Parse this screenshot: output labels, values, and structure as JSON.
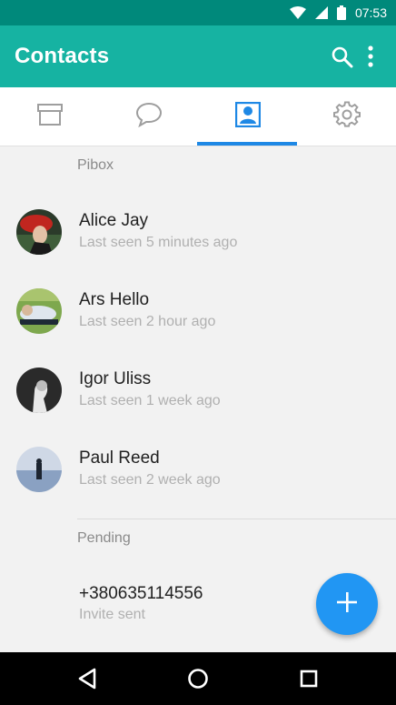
{
  "status_bar": {
    "time": "07:53"
  },
  "app_bar": {
    "title": "Contacts"
  },
  "tabs": [
    {
      "name": "archive",
      "icon": "archive-icon"
    },
    {
      "name": "chats",
      "icon": "chat-bubble-icon"
    },
    {
      "name": "contacts",
      "icon": "contact-card-icon",
      "selected": true
    },
    {
      "name": "settings",
      "icon": "gear-icon"
    }
  ],
  "sections": {
    "pibox": "Pibox",
    "pending": "Pending"
  },
  "contacts": [
    {
      "name": "Alice Jay",
      "status": "Last seen 5 minutes ago"
    },
    {
      "name": "Ars Hello",
      "status": "Last seen 2 hour ago"
    },
    {
      "name": "Igor Uliss",
      "status": "Last seen 1 week ago"
    },
    {
      "name": "Paul Reed",
      "status": "Last seen 2 week ago"
    }
  ],
  "pending": [
    {
      "number": "+380635114556",
      "status": "Invite sent"
    }
  ],
  "colors": {
    "status_bar": "#00897b",
    "app_bar": "#16b3a2",
    "accent": "#1e88e5",
    "fab": "#2196f3"
  }
}
